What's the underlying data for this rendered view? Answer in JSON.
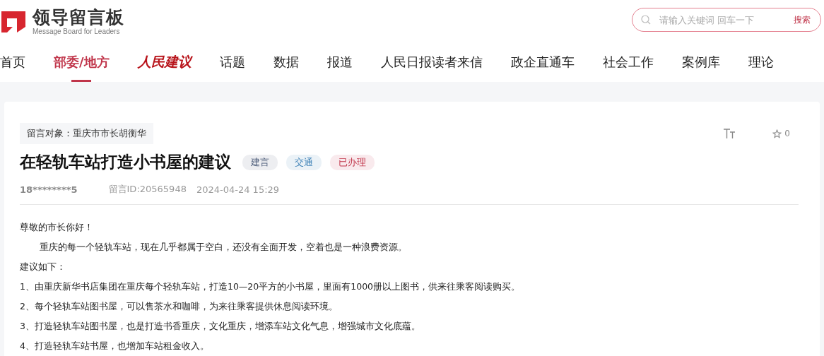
{
  "logo": {
    "title": "领导留言板",
    "subtitle": "Message Board for Leaders"
  },
  "search": {
    "placeholder": "请输入关键词 回车一下",
    "button": "搜索"
  },
  "nav": [
    {
      "label": "首页",
      "kind": "text",
      "selected": false
    },
    {
      "label": "部委/地方",
      "kind": "text",
      "selected": true
    },
    {
      "label": "人民建议",
      "kind": "logo",
      "selected": false
    },
    {
      "label": "话题",
      "kind": "text",
      "selected": false
    },
    {
      "label": "数据",
      "kind": "text",
      "selected": false
    },
    {
      "label": "报道",
      "kind": "text",
      "selected": false
    },
    {
      "label": "人民日报读者来信",
      "kind": "text",
      "selected": false
    },
    {
      "label": "政企直通车",
      "kind": "text",
      "selected": false
    },
    {
      "label": "社会工作",
      "kind": "text",
      "selected": false
    },
    {
      "label": "案例库",
      "kind": "text",
      "selected": false
    },
    {
      "label": "理论",
      "kind": "text",
      "selected": false
    }
  ],
  "message": {
    "recipient": "留言对象：重庆市市长胡衡华",
    "favorites": "0",
    "title": "在轻轨车站打造小书屋的建议",
    "tags": [
      {
        "label": "建言",
        "color": "#4a5a78"
      },
      {
        "label": "交通",
        "color": "#3a7fb5"
      },
      {
        "label": "已办理",
        "color": "#c0354a"
      }
    ],
    "author": "18********5",
    "id": "留言ID:20565948",
    "time": "2024-04-24 15:29",
    "body": [
      {
        "text": "尊敬的市长你好！",
        "kind": "line"
      },
      {
        "text": "重庆的每一个轻轨车站，现在几乎都属于空白，还没有全面开发，空着也是一种浪费资源。",
        "kind": "indent"
      },
      {
        "text": "建议如下：",
        "kind": "line"
      },
      {
        "text": "1、由重庆新华书店集团在重庆每个轻轨车站，打造10—20平方的小书屋，里面有1000册以上图书，供来往乘客阅读购买。",
        "kind": "line"
      },
      {
        "text": "2、每个轻轨车站图书屋，可以售茶水和咖啡，为来往乘客提供休息阅读环境。",
        "kind": "line"
      },
      {
        "text": "3、打造轻轨车站图书屋，也是打造书香重庆，文化重庆，增添车站文化气息，增强城市文化底蕴。",
        "kind": "line"
      },
      {
        "text": "4、打造轻轨车站书屋，也增加车站租金收入。",
        "kind": "line"
      }
    ]
  }
}
